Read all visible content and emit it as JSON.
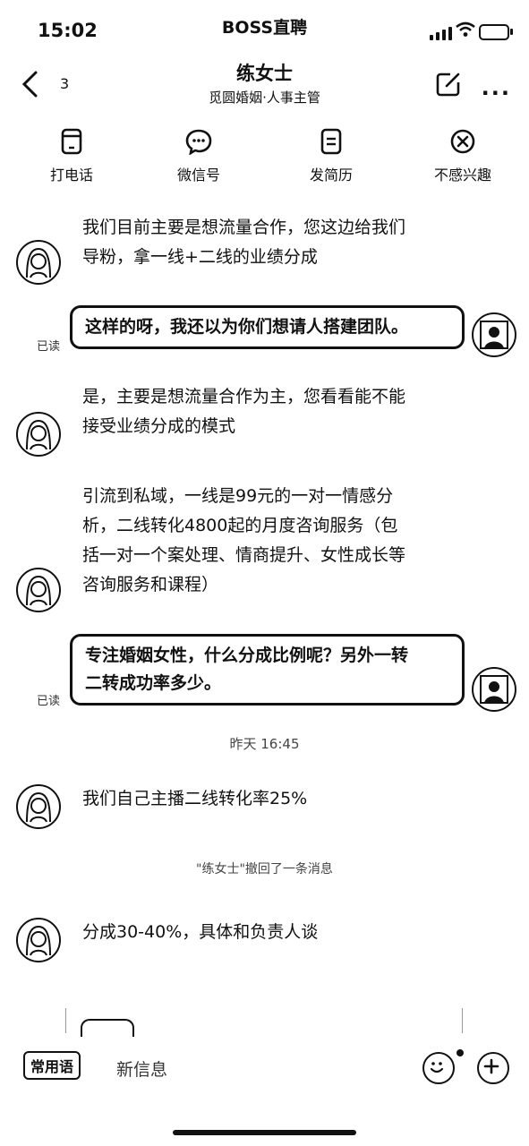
{
  "status": {
    "time": "15:02",
    "app_name": "BOSS直聘"
  },
  "nav": {
    "back_count": "3",
    "title": "练女士",
    "subtitle": "觅圆婚姻·人事主管"
  },
  "actions": [
    {
      "label": "打电话",
      "icon": "phone-icon"
    },
    {
      "label": "微信号",
      "icon": "wechat-icon"
    },
    {
      "label": "发简历",
      "icon": "resume-icon"
    },
    {
      "label": "不感兴趣",
      "icon": "not-interested-icon"
    }
  ],
  "messages": {
    "m1": {
      "line1": "我们目前主要是想流量合作，您这边给我们",
      "line2": "导粉，拿一线+二线的业绩分成"
    },
    "m2": {
      "text": "这样的呀，我还以为你们想请人搭建团队。",
      "read": "已读"
    },
    "m3": {
      "line1": "是，主要是想流量合作为主，您看看能不能",
      "line2": "接受业绩分成的模式"
    },
    "m4": {
      "line1": "引流到私域，一线是99元的一对一情感分",
      "line2": "析，二线转化4800起的月度咨询服务（包",
      "line3": "括一对一个案处理、情商提升、女性成长等",
      "line4": "咨询服务和课程）"
    },
    "m5": {
      "line1": "专注婚姻女性，什么分成比例呢？另外一转",
      "line2": "二转成功率多少。",
      "read": "已读"
    },
    "timestamp": "昨天 16:45",
    "m6": {
      "text": "我们自己主播二线转化率25%"
    },
    "recall": "\"练女士\"撤回了一条消息",
    "m7": {
      "text": "分成30-40%，具体和负责人谈"
    }
  },
  "bottom": {
    "quick_phrase": "常用语",
    "input_placeholder": "新信息"
  }
}
